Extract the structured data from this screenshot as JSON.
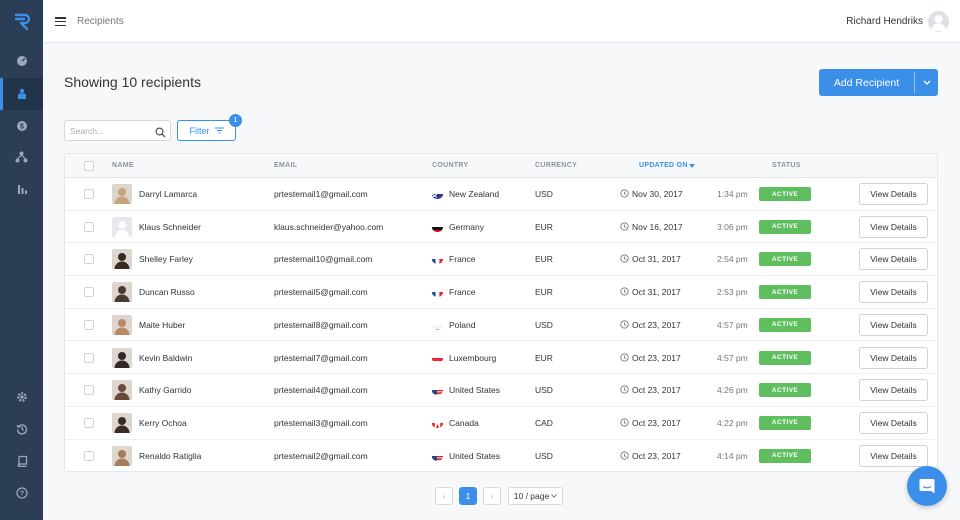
{
  "header": {
    "breadcrumb": "Recipients",
    "user_name": "Richard Hendriks"
  },
  "page": {
    "title": "Showing 10 recipients",
    "add_button_label": "Add Recipient",
    "search_placeholder": "Search...",
    "filter_label": "Filter",
    "filter_count": "1"
  },
  "sidebar": {
    "top_icons": [
      "dashboard-icon",
      "recipients-icon",
      "currency-icon",
      "network-icon",
      "reports-icon"
    ],
    "bottom_icons": [
      "settings-icon",
      "history-icon",
      "book-icon",
      "help-icon"
    ]
  },
  "table": {
    "columns": {
      "name": "NAME",
      "email": "EMAIL",
      "country": "COUNTRY",
      "currency": "CURRENCY",
      "updated_on": "UPDATED ON",
      "status": "STATUS"
    },
    "rows": [
      {
        "name": "Darryl Lamarca",
        "email": "prtestemail1@gmail.com",
        "country": "New Zealand",
        "flag": "nz",
        "currency": "USD",
        "date": "Nov 30, 2017",
        "time": "1:34 pm",
        "status": "ACTIVE",
        "action": "View Details"
      },
      {
        "name": "Klaus Schneider",
        "email": "klaus.schneider@yahoo.com",
        "country": "Germany",
        "flag": "de",
        "currency": "EUR",
        "date": "Nov 16, 2017",
        "time": "3:06 pm",
        "status": "ACTIVE",
        "action": "View Details"
      },
      {
        "name": "Shelley Farley",
        "email": "prtestemail10@gmail.com",
        "country": "France",
        "flag": "fr",
        "currency": "EUR",
        "date": "Oct 31, 2017",
        "time": "2:54 pm",
        "status": "ACTIVE",
        "action": "View Details"
      },
      {
        "name": "Duncan Russo",
        "email": "prtestemail5@gmail.com",
        "country": "France",
        "flag": "fr",
        "currency": "EUR",
        "date": "Oct 31, 2017",
        "time": "2:53 pm",
        "status": "ACTIVE",
        "action": "View Details"
      },
      {
        "name": "Maite Huber",
        "email": "prtestemail8@gmail.com",
        "country": "Poland",
        "flag": "pl",
        "currency": "USD",
        "date": "Oct 23, 2017",
        "time": "4:57 pm",
        "status": "ACTIVE",
        "action": "View Details"
      },
      {
        "name": "Kevin Baldwin",
        "email": "prtestemail7@gmail.com",
        "country": "Luxembourg",
        "flag": "lu",
        "currency": "EUR",
        "date": "Oct 23, 2017",
        "time": "4:57 pm",
        "status": "ACTIVE",
        "action": "View Details"
      },
      {
        "name": "Kathy Garrido",
        "email": "prtestemail4@gmail.com",
        "country": "United States",
        "flag": "us",
        "currency": "USD",
        "date": "Oct 23, 2017",
        "time": "4:26 pm",
        "status": "ACTIVE",
        "action": "View Details"
      },
      {
        "name": "Kerry Ochoa",
        "email": "prtestemail3@gmail.com",
        "country": "Canada",
        "flag": "ca",
        "currency": "CAD",
        "date": "Oct 23, 2017",
        "time": "4:22 pm",
        "status": "ACTIVE",
        "action": "View Details"
      },
      {
        "name": "Renaldo Ratiglia",
        "email": "prtestemail2@gmail.com",
        "country": "United States",
        "flag": "us",
        "currency": "USD",
        "date": "Oct 23, 2017",
        "time": "4:14 pm",
        "status": "ACTIVE",
        "action": "View Details"
      }
    ]
  },
  "pagination": {
    "prev": "‹",
    "current_page": "1",
    "next": "›",
    "page_size": "10 / page"
  },
  "colors": {
    "sidebar": "#2c3e55",
    "accent": "#3b8fe9",
    "active_status": "#5fbf5f"
  }
}
